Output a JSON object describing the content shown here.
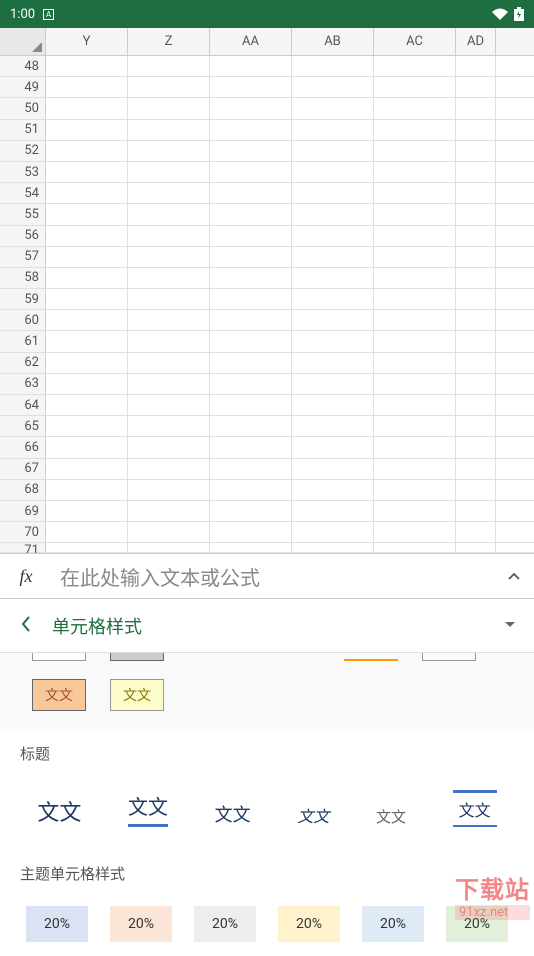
{
  "status": {
    "time": "1:00",
    "icon_label": "A"
  },
  "columns": [
    "Y",
    "Z",
    "AA",
    "AB",
    "AC",
    "AD"
  ],
  "rows": [
    48,
    49,
    50,
    51,
    52,
    53,
    54,
    55,
    56,
    57,
    58,
    59,
    60,
    61,
    62,
    63,
    64,
    65,
    66,
    67,
    68,
    69,
    70,
    71
  ],
  "formula": {
    "fx": "fx",
    "placeholder": "在此处输入文本或公式"
  },
  "panel": {
    "title": "单元格样式",
    "swatch_text": "文文",
    "section_heading": "标题",
    "section_theme": "主题单元格样式",
    "theme_pct": "20%"
  },
  "watermark": {
    "top": "下载站",
    "bottom": "91xz.net"
  }
}
